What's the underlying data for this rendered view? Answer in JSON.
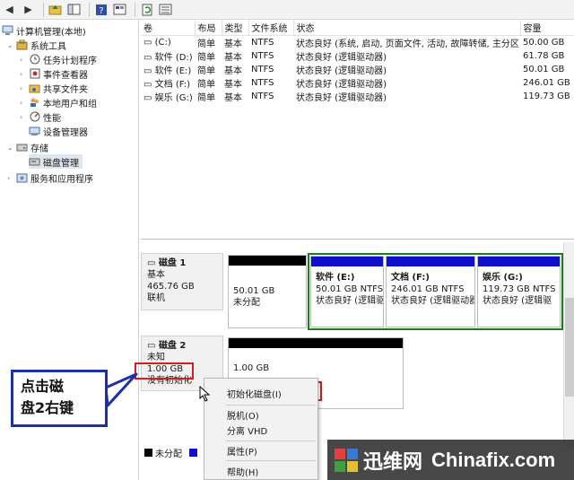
{
  "tree": {
    "root": "计算机管理(本地)",
    "system_tools": "系统工具",
    "task_scheduler": "任务计划程序",
    "event_viewer": "事件查看器",
    "shared_folders": "共享文件夹",
    "local_users": "本地用户和组",
    "performance": "性能",
    "device_manager": "设备管理器",
    "storage": "存储",
    "disk_management": "磁盘管理",
    "services_apps": "服务和应用程序"
  },
  "volume_table": {
    "headers": [
      "卷",
      "布局",
      "类型",
      "文件系统",
      "状态",
      "容量"
    ],
    "rows": [
      [
        "(C:)",
        "简单",
        "基本",
        "NTFS",
        "状态良好 (系统, 启动, 页面文件, 活动, 故障转储, 主分区)",
        "50.00 GB"
      ],
      [
        "软件 (D:)",
        "简单",
        "基本",
        "NTFS",
        "状态良好 (逻辑驱动器)",
        "61.78 GB"
      ],
      [
        "软件 (E:)",
        "简单",
        "基本",
        "NTFS",
        "状态良好 (逻辑驱动器)",
        "50.01 GB"
      ],
      [
        "文档 (F:)",
        "简单",
        "基本",
        "NTFS",
        "状态良好 (逻辑驱动器)",
        "246.01 GB"
      ],
      [
        "娱乐 (G:)",
        "简单",
        "基本",
        "NTFS",
        "状态良好 (逻辑驱动器)",
        "119.73 GB"
      ]
    ]
  },
  "disk1": {
    "title": "磁盘 1",
    "type": "基本",
    "size": "465.76 GB",
    "status": "联机",
    "partitions": [
      {
        "name": "",
        "size": "50.01 GB",
        "status": "未分配"
      },
      {
        "name": "软件 (E:)",
        "size": "50.01 GB NTFS",
        "status": "状态良好 (逻辑驱"
      },
      {
        "name": "文档 (F:)",
        "size": "246.01 GB NTFS",
        "status": "状态良好 (逻辑驱动器"
      },
      {
        "name": "娱乐 (G:)",
        "size": "119.73 GB NTFS",
        "status": "状态良好 (逻辑驱"
      }
    ]
  },
  "disk2": {
    "title": "磁盘 2",
    "type": "未知",
    "size": "1.00 GB",
    "status": "没有初始化",
    "partition_size": "1.00 GB"
  },
  "legend": {
    "unallocated": "未分配"
  },
  "context_menu": {
    "initialize": "初始化磁盘(I)",
    "offline": "脱机(O)",
    "detach_vhd": "分离 VHD",
    "properties": "属性(P)",
    "help": "帮助(H)"
  },
  "callout": {
    "line1": "点击磁",
    "line2": "盘2右键"
  },
  "watermark": {
    "cn": "迅维网",
    "en": "Chinafix.com"
  },
  "colors": {
    "primary_partition_bar": "#1010cc",
    "unallocated_bar": "#000000",
    "extended_border": "#1a7d1a",
    "highlight_red": "#d21e1e",
    "callout_border": "#1f2fa6"
  }
}
